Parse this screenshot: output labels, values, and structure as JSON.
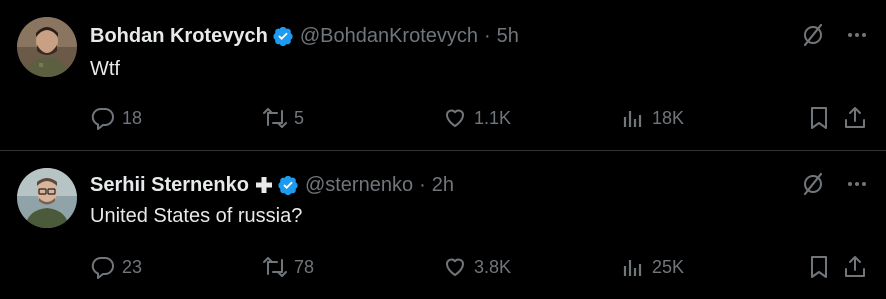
{
  "tweets": [
    {
      "display_name": "Bohdan Krotevych",
      "handle": "@BohdanKrotevych",
      "separator": "·",
      "time": "5h",
      "text": "Wtf",
      "replies": "18",
      "retweets": "5",
      "likes": "1.1K",
      "views": "18K",
      "avatar_icon": "avatar-man-beard-uniform"
    },
    {
      "display_name": "Serhii Sternenko",
      "handle": "@sternenko",
      "separator": "·",
      "time": "2h",
      "text": "United States of russia?",
      "replies": "23",
      "retweets": "78",
      "likes": "3.8K",
      "views": "25K",
      "avatar_icon": "avatar-man-glasses-jacket"
    }
  ],
  "icons": {
    "verified": "verified-badge-icon",
    "plus": "plus-icon",
    "grok": "grok-icon",
    "more": "more-icon",
    "reply": "reply-icon",
    "retweet": "retweet-icon",
    "like": "heart-icon",
    "views": "views-icon",
    "bookmark": "bookmark-icon",
    "share": "share-icon"
  },
  "colors": {
    "background": "#000000",
    "primary_text": "#e7e9ea",
    "secondary_text": "#71767b",
    "divider": "#2f3336",
    "verified_blue": "#1d9bf0"
  }
}
